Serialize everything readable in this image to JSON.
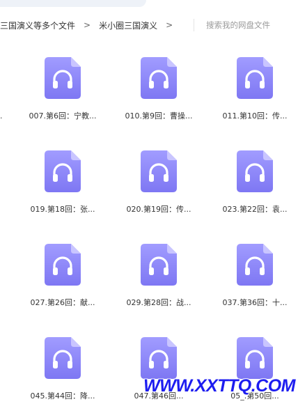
{
  "breadcrumb": {
    "items": [
      "三国演义等多个文件",
      "米小圈三国演义"
    ],
    "separator": ">"
  },
  "search": {
    "placeholder": "搜索我的网盘文件"
  },
  "files": [
    {
      "name": "007.第6回：宁教..."
    },
    {
      "name": "010.第9回：曹操..."
    },
    {
      "name": "011.第10回：传..."
    },
    {
      "name": "019.第18回：张..."
    },
    {
      "name": "020.第19回：传..."
    },
    {
      "name": "023.第22回：袁..."
    },
    {
      "name": "027.第26回：献..."
    },
    {
      "name": "029.第28回：战..."
    },
    {
      "name": "037.第36回：十..."
    },
    {
      "name": "045.第44回：降..."
    },
    {
      "name": "047.第46回..."
    },
    {
      "name": "05_.第50回..."
    }
  ],
  "stray_text": ".",
  "icons": {
    "file_type": "audio-file-icon",
    "glyph": "headphones"
  },
  "colors": {
    "icon_top": "#a19cff",
    "icon_bottom": "#7e77f3",
    "icon_fold": "#c9c5ff",
    "watermark": "#1d1df0"
  },
  "watermark": "WWW.XXTTQ.COM"
}
